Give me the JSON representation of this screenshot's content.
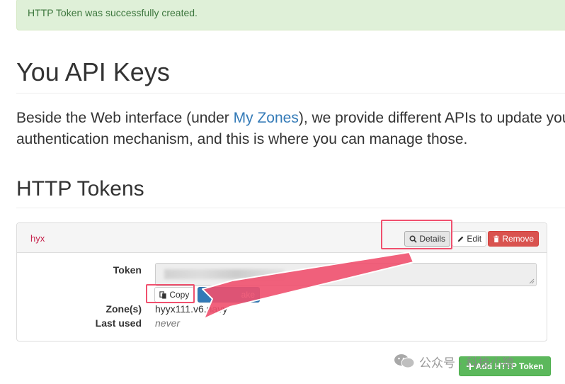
{
  "alert": {
    "message": "HTTP Token was successfully created."
  },
  "page": {
    "title": "You API Keys",
    "intro_before": "Beside the Web interface (under ",
    "intro_link": "My Zones",
    "intro_after": "), we provide different APIs to update you",
    "intro_line2": "authentication mechanism, and this is where you can manage those."
  },
  "section": {
    "title": "HTTP Tokens"
  },
  "token": {
    "name": "hyx",
    "details_label": "Details",
    "edit_label": "Edit",
    "remove_label": "Remove",
    "token_label": "Token",
    "copy_label": "Copy",
    "regenerate_label": "ake",
    "zones_label": "Zone(s)",
    "zones_value": "hyyx111.v6.navy",
    "last_used_label": "Last used",
    "last_used_value": "never"
  },
  "add_button": {
    "label": "Add HTTP Token"
  },
  "watermark": {
    "text": "公众号 · 科技小猿"
  },
  "colors": {
    "alert_bg": "#dff0d8",
    "link": "#337ab7",
    "danger": "#d9534f",
    "primary": "#337ab7",
    "success": "#5cb85c",
    "annotation": "#f0506e"
  },
  "icons": [
    "search-icon",
    "pencil-icon",
    "trash-icon",
    "copy-icon",
    "plus-icon",
    "wechat-icon"
  ]
}
